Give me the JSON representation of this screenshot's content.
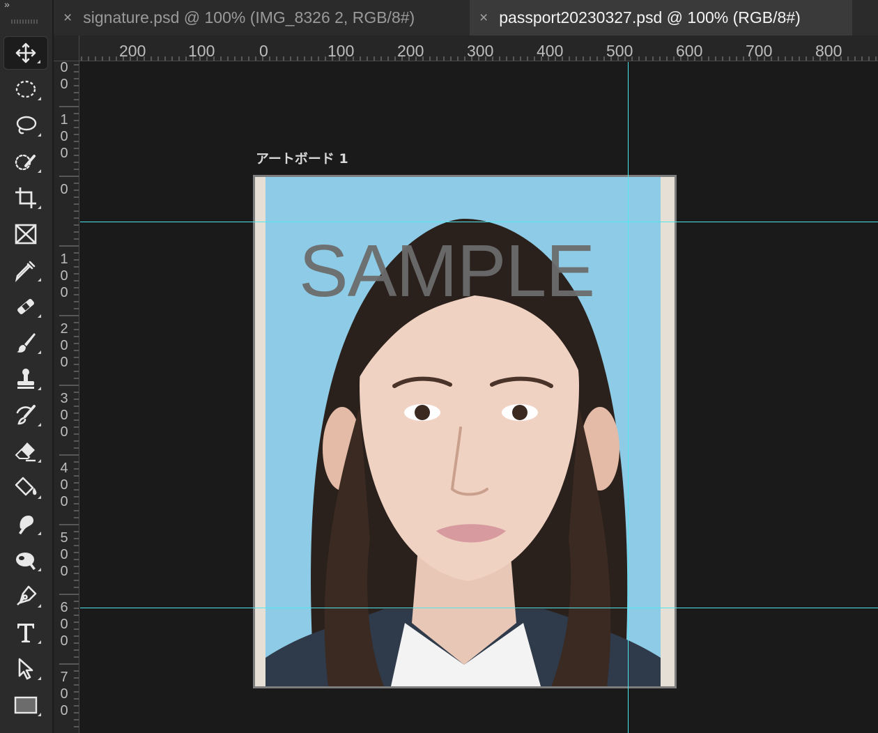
{
  "toolbar": {
    "collapse_glyph": "»",
    "tools": [
      {
        "icon": "move-icon",
        "active": true
      },
      {
        "icon": "elliptical-marquee-icon"
      },
      {
        "icon": "lasso-icon"
      },
      {
        "icon": "quick-selection-icon"
      },
      {
        "icon": "crop-icon"
      },
      {
        "icon": "frame-icon"
      },
      {
        "icon": "eyedropper-icon"
      },
      {
        "icon": "healing-brush-icon"
      },
      {
        "icon": "brush-icon"
      },
      {
        "icon": "clone-stamp-icon"
      },
      {
        "icon": "history-brush-icon"
      },
      {
        "icon": "eraser-icon"
      },
      {
        "icon": "paint-bucket-icon"
      },
      {
        "icon": "smudge-icon"
      },
      {
        "icon": "dodge-icon"
      },
      {
        "icon": "pen-icon"
      },
      {
        "icon": "type-icon"
      },
      {
        "icon": "path-selection-icon"
      },
      {
        "icon": "rectangle-icon"
      }
    ]
  },
  "tabs": [
    {
      "label": "signature.psd @ 100% (IMG_8326 2, RGB/8#)",
      "close": "×",
      "active": false
    },
    {
      "label": "passport20230327.psd @ 100% (RGB/8#)",
      "close": "×",
      "active": true
    }
  ],
  "ruler_h": {
    "labels": [
      "200",
      "100",
      "0",
      "100",
      "200",
      "300",
      "400",
      "500",
      "600",
      "700",
      "800"
    ]
  },
  "ruler_v": {
    "labels": [
      [
        "0",
        "0"
      ],
      [
        "1",
        "0",
        "0"
      ],
      [
        "0"
      ],
      [
        "1",
        "0",
        "0"
      ],
      [
        "2",
        "0",
        "0"
      ],
      [
        "3",
        "0",
        "0"
      ],
      [
        "4",
        "0",
        "0"
      ],
      [
        "5",
        "0",
        "0"
      ],
      [
        "6",
        "0",
        "0"
      ],
      [
        "7",
        "0",
        "0"
      ]
    ]
  },
  "artboard": {
    "label": "アートボード 1",
    "watermark": "SAMPLE"
  },
  "colors": {
    "guide": "#4ee7ee",
    "photo_background": "#8dcbe6",
    "canvas": "#1a1a1a"
  }
}
